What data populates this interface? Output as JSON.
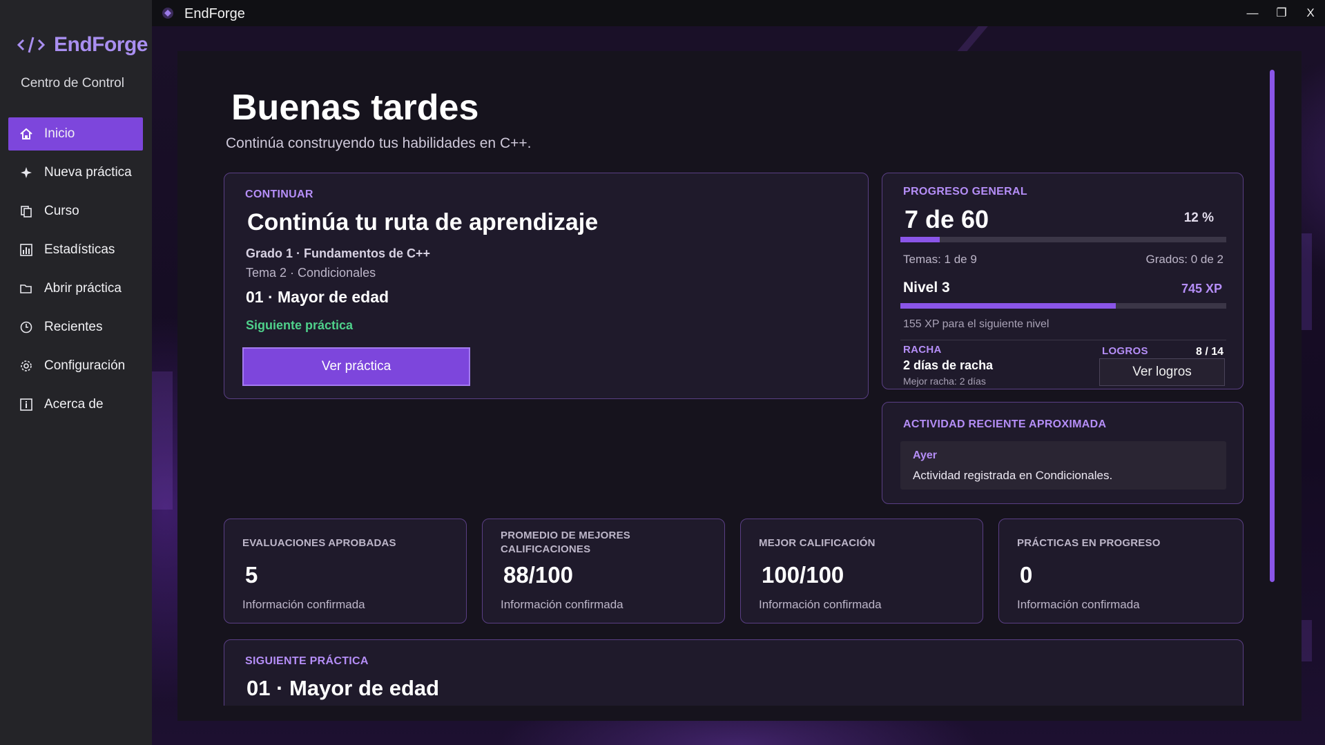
{
  "window": {
    "title": "EndForge",
    "controls": {
      "minimize": "—",
      "maximize": "❐",
      "close": "X"
    }
  },
  "sidebar": {
    "brand": "EndForge",
    "subtitle": "Centro de Control",
    "items": [
      {
        "label": "Inicio",
        "icon": "home-icon",
        "active": true
      },
      {
        "label": "Nueva práctica",
        "icon": "sparkle-icon",
        "active": false
      },
      {
        "label": "Curso",
        "icon": "book-icon",
        "active": false
      },
      {
        "label": "Estadísticas",
        "icon": "bar-chart-icon",
        "active": false
      },
      {
        "label": "Abrir práctica",
        "icon": "folder-icon",
        "active": false
      },
      {
        "label": "Recientes",
        "icon": "clock-icon",
        "active": false
      },
      {
        "label": "Configuración",
        "icon": "gear-icon",
        "active": false
      },
      {
        "label": "Acerca de",
        "icon": "info-icon",
        "active": false
      }
    ]
  },
  "header": {
    "greeting": "Buenas tardes",
    "subtitle": "Continúa construyendo tus habilidades en C++."
  },
  "continue_card": {
    "label": "CONTINUAR",
    "title": "Continúa tu ruta de aprendizaje",
    "grade": "Grado 1 · Fundamentos de C++",
    "topic": "Tema 2 · Condicionales",
    "practice": "01 · Mayor de edad",
    "next_label": "Siguiente práctica",
    "button": "Ver práctica"
  },
  "progress_card": {
    "label": "PROGRESO GENERAL",
    "count": "7 de 60",
    "percent": "12 %",
    "progress_fraction": 0.12,
    "topics": "Temas: 1 de 9",
    "grades": "Grados: 0 de 2",
    "level": "Nivel 3",
    "xp": "745 XP",
    "level_fraction": 0.66,
    "next_level": "155 XP para el siguiente nivel",
    "streak_label": "RACHA",
    "streak": "2 días de racha",
    "best_streak": "Mejor racha: 2 días",
    "achievements_label": "LOGROS",
    "achievements": "8 / 14",
    "achievements_button": "Ver logros"
  },
  "activity_card": {
    "label": "ACTIVIDAD RECIENTE APROXIMADA",
    "when": "Ayer",
    "text": "Actividad registrada en Condicionales."
  },
  "stats": [
    {
      "label": "EVALUACIONES APROBADAS",
      "value": "5",
      "note": "Información confirmada"
    },
    {
      "label": "PROMEDIO DE MEJORES CALIFICACIONES",
      "value": "88/100",
      "note": "Información confirmada"
    },
    {
      "label": "MEJOR CALIFICACIÓN",
      "value": "100/100",
      "note": "Información confirmada"
    },
    {
      "label": "PRÁCTICAS EN PROGRESO",
      "value": "0",
      "note": "Información confirmada"
    }
  ],
  "next_card": {
    "label": "SIGUIENTE PRÁCTICA",
    "title": "01 · Mayor de edad"
  },
  "colors": {
    "accent": "#7d46dc",
    "accent_light": "#b58ef7",
    "success": "#4fd18b"
  }
}
